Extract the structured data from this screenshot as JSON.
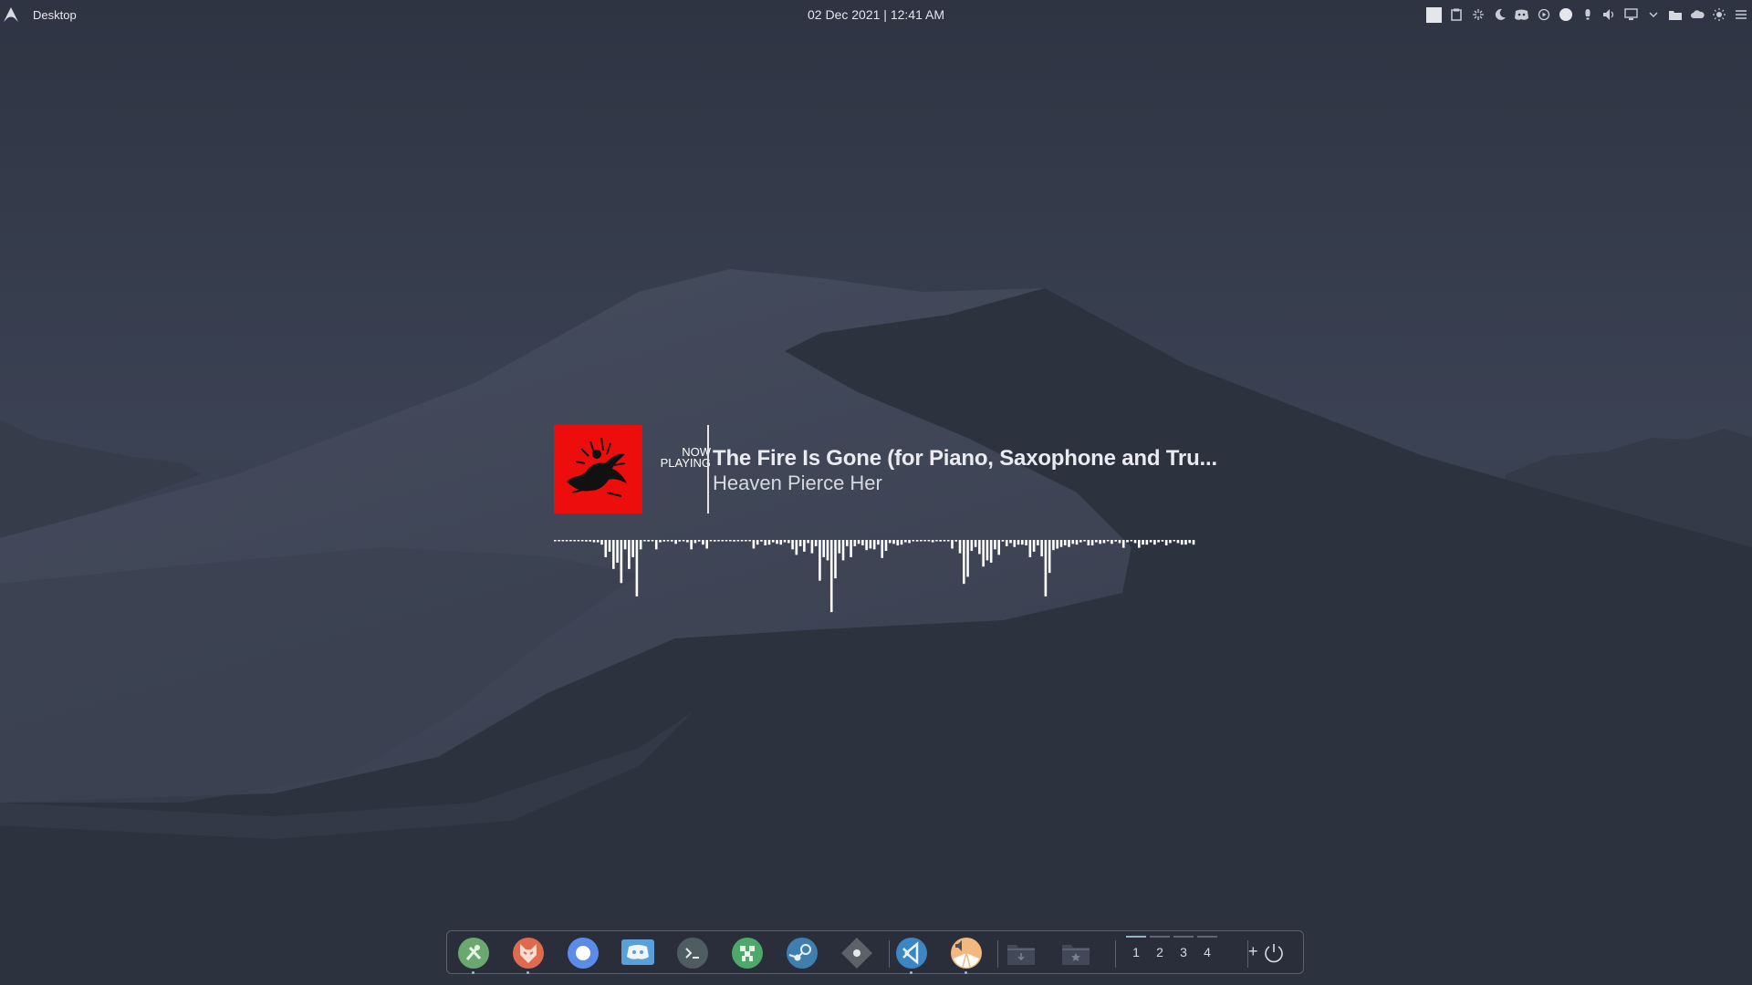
{
  "topbar": {
    "launcher_icon": "arch-launcher-icon",
    "window_title": "Desktop",
    "clock": "02 Dec 2021 | 12:41 AM",
    "tray_icons": [
      "window-square-icon",
      "clipboard-icon",
      "network-activity-icon",
      "night-mode-icon",
      "discord-tray-icon",
      "media-play-icon",
      "status-circle-icon",
      "notifications-icon",
      "volume-icon",
      "display-icon",
      "expand-tray-icon",
      "folder-icon",
      "weather-cloud-icon",
      "brightness-icon",
      "menu-icon"
    ]
  },
  "now_playing": {
    "label_line1": "NOW",
    "label_line2": "PLAYING",
    "title": "The Fire Is Gone (for Piano, Saxophone and Tru...",
    "artist": "Heaven Pierce Her",
    "album_art_color": "#ee0d0d",
    "visualizer_levels": [
      0.01,
      0.01,
      0.01,
      0.01,
      0.01,
      0.01,
      0.01,
      0.01,
      0.02,
      0.02,
      0.03,
      0.03,
      0.06,
      0.22,
      0.15,
      0.37,
      0.29,
      0.55,
      0.12,
      0.37,
      0.22,
      0.72,
      0.12,
      0.01,
      0.02,
      0.01,
      0.12,
      0.03,
      0.02,
      0.01,
      0.02,
      0.05,
      0.02,
      0.01,
      0.03,
      0.12,
      0.04,
      0.02,
      0.06,
      0.11,
      0.01,
      0.02,
      0.01,
      0.01,
      0.01,
      0.01,
      0.02,
      0.01,
      0.01,
      0.01,
      0.01,
      0.11,
      0.06,
      0.02,
      0.07,
      0.06,
      0.03,
      0.05,
      0.06,
      0.03,
      0.04,
      0.12,
      0.19,
      0.08,
      0.15,
      0.04,
      0.17,
      0.08,
      0.52,
      0.22,
      0.26,
      0.92,
      0.49,
      0.17,
      0.26,
      0.08,
      0.22,
      0.08,
      0.05,
      0.07,
      0.13,
      0.11,
      0.12,
      0.06,
      0.23,
      0.14,
      0.04,
      0.05,
      0.07,
      0.06,
      0.03,
      0.04,
      0.01,
      0.02,
      0.01,
      0.01,
      0.01,
      0.03,
      0.01,
      0.02,
      0.01,
      0.01,
      0.11,
      0.02,
      0.17,
      0.56,
      0.47,
      0.14,
      0.09,
      0.18,
      0.34,
      0.26,
      0.29,
      0.12,
      0.19,
      0.02,
      0.08,
      0.04,
      0.09,
      0.06,
      0.06,
      0.07,
      0.22,
      0.15,
      0.07,
      0.21,
      0.72,
      0.42,
      0.13,
      0.11,
      0.09,
      0.07,
      0.09,
      0.05,
      0.06,
      0.03,
      0.01,
      0.07,
      0.07,
      0.03,
      0.05,
      0.04,
      0.01,
      0.05,
      0.02,
      0.04,
      0.1,
      0.03,
      0.01,
      0.04,
      0.1,
      0.06,
      0.06,
      0.03,
      0.06,
      0.03,
      0.02,
      0.07,
      0.04,
      0.01,
      0.04,
      0.06,
      0.06,
      0.04,
      0.06
    ]
  },
  "dock": {
    "apps": [
      {
        "name": "manjaro-settings",
        "icon": "settings-app-icon",
        "color": "#6aa86f",
        "running": true
      },
      {
        "name": "firefox",
        "icon": "firefox-fox-icon",
        "color": "#e06a4e",
        "running": true
      },
      {
        "name": "chromium",
        "icon": "chromium-icon",
        "color": "#5b8de8",
        "running": false
      },
      {
        "name": "discord",
        "icon": "discord-icon",
        "color": "#5aa0d8",
        "running": false
      },
      {
        "name": "terminal",
        "icon": "terminal-icon",
        "color": "#4f5d63",
        "running": false
      },
      {
        "name": "minecraft",
        "icon": "minecraft-icon",
        "color": "#4ea86a",
        "running": false
      },
      {
        "name": "steam",
        "icon": "steam-icon",
        "color": "#3e7fb0",
        "running": false
      },
      {
        "name": "obs",
        "icon": "obs-record-icon",
        "color": "#5d6168",
        "running": false
      },
      {
        "name": "vscode",
        "icon": "vscode-icon",
        "color": "#3d86c4",
        "running": true
      },
      {
        "name": "audacious",
        "icon": "audio-player-icon",
        "color": "#f2b880",
        "running": true
      },
      {
        "name": "downloads",
        "icon": "downloads-folder-icon",
        "color": "#424857",
        "running": false
      },
      {
        "name": "favorites",
        "icon": "starred-folder-icon",
        "color": "#424857",
        "running": false
      }
    ],
    "desktops": [
      "1",
      "2",
      "3",
      "4"
    ],
    "active_desktop": "1",
    "add_desktop_label": "+",
    "power_icon": "power-icon"
  }
}
